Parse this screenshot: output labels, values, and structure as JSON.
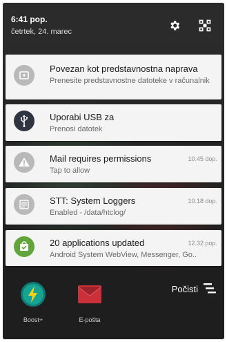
{
  "status": {
    "time": "6:41 pop.",
    "date": "četrtek, 24. marec",
    "icons": [
      "gear-icon",
      "quick-settings-icon"
    ]
  },
  "notifications": [
    {
      "icon": "screen-share-icon",
      "icon_color": "#b9b9b9",
      "title": "Povezan kot predstavnostna naprava",
      "subtitle": "Prenesite predstavnostne datoteke v računalnik",
      "time": ""
    },
    {
      "icon": "usb-icon",
      "icon_color": "#2e3440",
      "title": "Uporabi USB za",
      "subtitle": "Prenosi datotek",
      "time": ""
    },
    {
      "icon": "warning-icon",
      "icon_color": "#b9b9b9",
      "title": "Mail requires permissions",
      "subtitle": "Tap to allow",
      "time": "10.45 dop."
    },
    {
      "icon": "log-icon",
      "icon_color": "#b9b9b9",
      "title": "STT: System Loggers",
      "subtitle": "Enabled - /data/htclog/",
      "time": "10.18 dop."
    },
    {
      "icon": "store-update-icon",
      "icon_color": "#62a53c",
      "title": "20 applications updated",
      "subtitle": "Android System WebView, Messenger, Go..",
      "time": "12.32 pop."
    }
  ],
  "dock": [
    {
      "icon": "boost-icon",
      "label": "Boost+"
    },
    {
      "icon": "email-icon",
      "label": "E-pošta"
    }
  ],
  "clear_all": {
    "label": "Počisti",
    "icon": "clear-all-icon"
  }
}
